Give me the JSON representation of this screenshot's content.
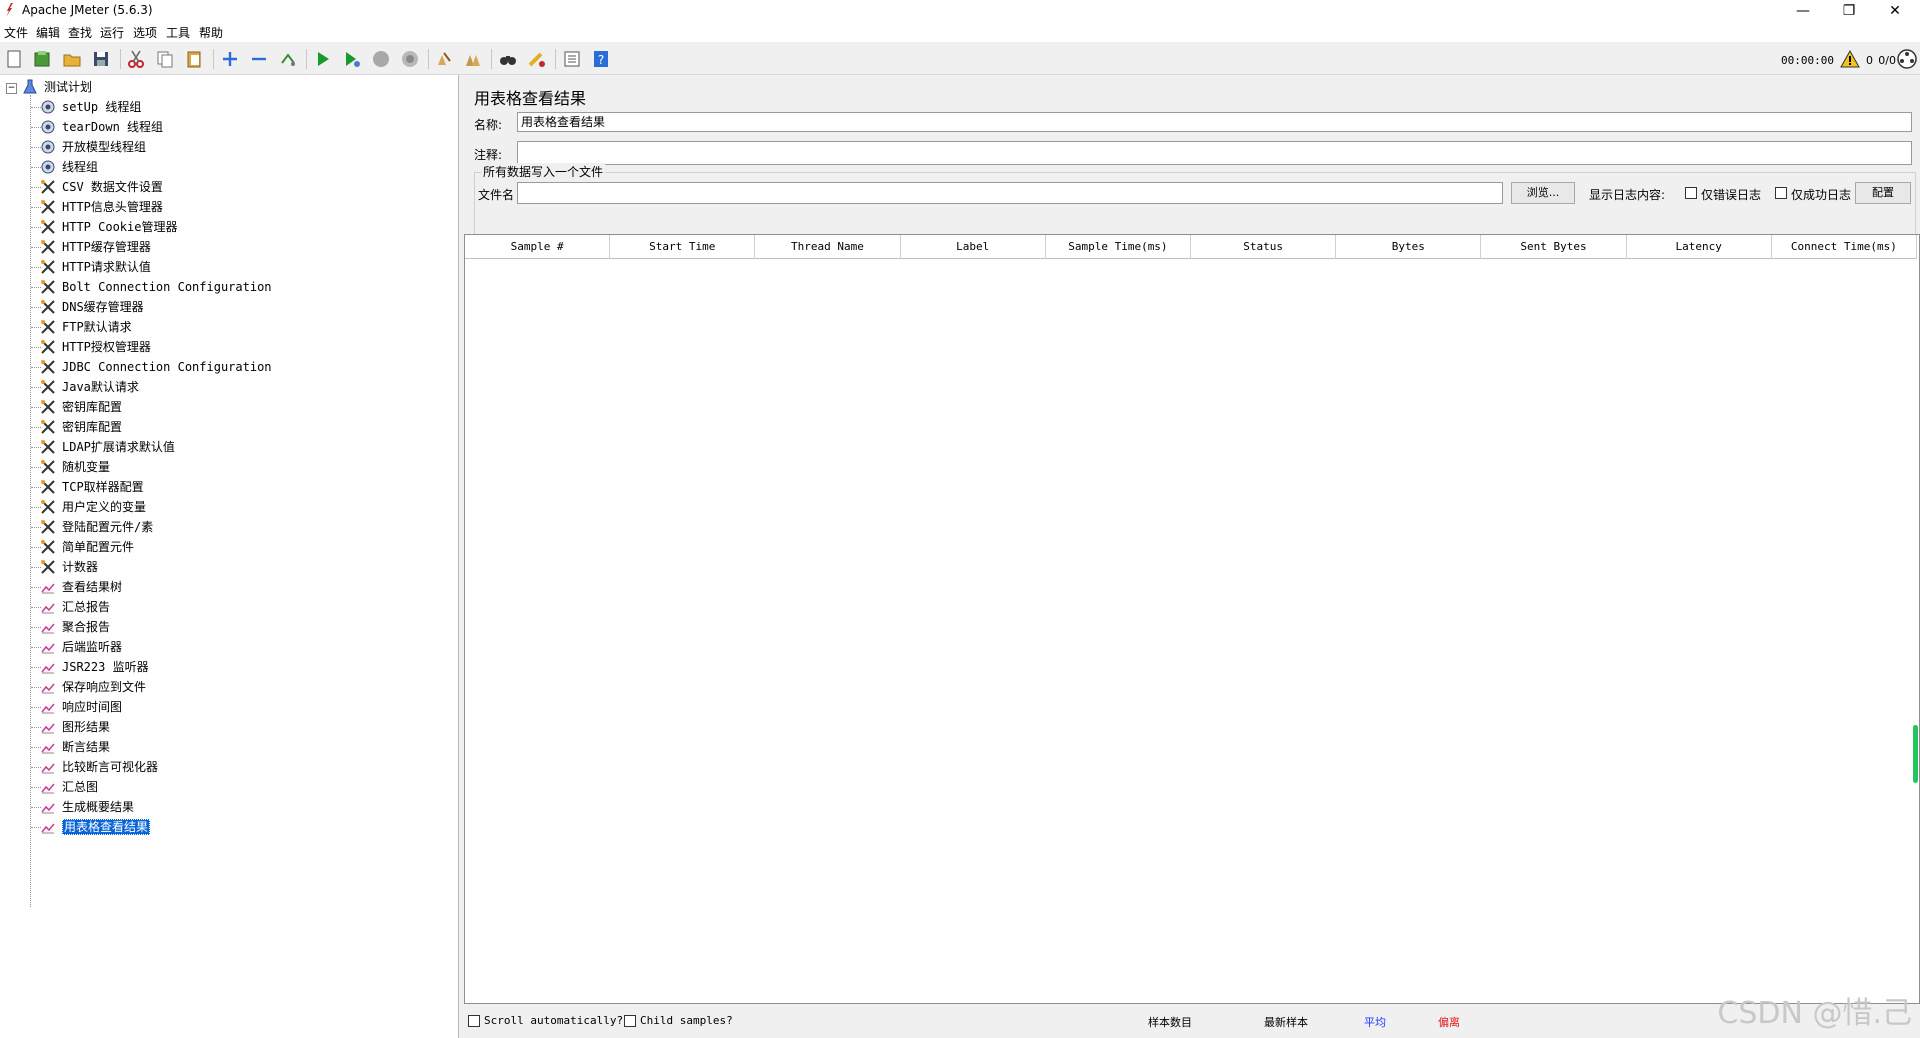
{
  "window": {
    "title": "Apache JMeter (5.6.3)",
    "minimize": "—",
    "restore": "❐",
    "close": "✕"
  },
  "menu": [
    "文件",
    "编辑",
    "查找",
    "运行",
    "选项",
    "工具",
    "帮助"
  ],
  "toolbar_status": {
    "elapsed": "00:00:00",
    "errors": "0",
    "threads": "0/0"
  },
  "tree": {
    "root": "测试计划",
    "items": [
      {
        "label": "setUp 线程组",
        "icon": "thread-group-icon"
      },
      {
        "label": "tearDown 线程组",
        "icon": "thread-group-icon"
      },
      {
        "label": "开放模型线程组",
        "icon": "thread-group-icon"
      },
      {
        "label": "线程组",
        "icon": "thread-group-icon"
      },
      {
        "label": "CSV 数据文件设置",
        "icon": "config-element-icon"
      },
      {
        "label": "HTTP信息头管理器",
        "icon": "config-element-icon"
      },
      {
        "label": "HTTP Cookie管理器",
        "icon": "config-element-icon"
      },
      {
        "label": "HTTP缓存管理器",
        "icon": "config-element-icon"
      },
      {
        "label": "HTTP请求默认值",
        "icon": "config-element-icon"
      },
      {
        "label": "Bolt Connection Configuration",
        "icon": "config-element-icon"
      },
      {
        "label": "DNS缓存管理器",
        "icon": "config-element-icon"
      },
      {
        "label": "FTP默认请求",
        "icon": "config-element-icon"
      },
      {
        "label": "HTTP授权管理器",
        "icon": "config-element-icon"
      },
      {
        "label": "JDBC Connection Configuration",
        "icon": "config-element-icon"
      },
      {
        "label": "Java默认请求",
        "icon": "config-element-icon"
      },
      {
        "label": "密钥库配置",
        "icon": "config-element-icon"
      },
      {
        "label": "密钥库配置",
        "icon": "config-element-icon"
      },
      {
        "label": "LDAP扩展请求默认值",
        "icon": "config-element-icon"
      },
      {
        "label": "随机变量",
        "icon": "config-element-icon"
      },
      {
        "label": "TCP取样器配置",
        "icon": "config-element-icon"
      },
      {
        "label": "用户定义的变量",
        "icon": "config-element-icon"
      },
      {
        "label": "登陆配置元件/素",
        "icon": "config-element-icon"
      },
      {
        "label": "简单配置元件",
        "icon": "config-element-icon"
      },
      {
        "label": "计数器",
        "icon": "config-element-icon"
      },
      {
        "label": "查看结果树",
        "icon": "listener-icon"
      },
      {
        "label": "汇总报告",
        "icon": "listener-icon"
      },
      {
        "label": "聚合报告",
        "icon": "listener-icon"
      },
      {
        "label": "后端监听器",
        "icon": "listener-icon"
      },
      {
        "label": "JSR223 监听器",
        "icon": "listener-icon"
      },
      {
        "label": "保存响应到文件",
        "icon": "listener-icon"
      },
      {
        "label": "响应时间图",
        "icon": "listener-icon"
      },
      {
        "label": "图形结果",
        "icon": "listener-icon"
      },
      {
        "label": "断言结果",
        "icon": "listener-icon"
      },
      {
        "label": "比较断言可视化器",
        "icon": "listener-icon"
      },
      {
        "label": "汇总图",
        "icon": "listener-icon"
      },
      {
        "label": "生成概要结果",
        "icon": "listener-icon"
      },
      {
        "label": "用表格查看结果",
        "icon": "listener-icon",
        "selected": true
      }
    ]
  },
  "panel": {
    "title": "用表格查看结果",
    "name_label": "名称:",
    "name_value": "用表格查看结果",
    "comment_label": "注释:",
    "comment_value": "",
    "file_section_title": "所有数据写入一个文件",
    "file_label": "文件名",
    "file_value": "",
    "browse_label": "浏览...",
    "log_content_label": "显示日志内容:",
    "errors_only_label": "仅错误日志",
    "success_only_label": "仅成功日志",
    "configure_label": "配置"
  },
  "table": {
    "columns": [
      "Sample #",
      "Start Time",
      "Thread Name",
      "Label",
      "Sample Time(ms)",
      "Status",
      "Bytes",
      "Sent Bytes",
      "Latency",
      "Connect Time(ms)"
    ]
  },
  "bottom": {
    "scroll_auto_label": "Scroll automatically?",
    "child_samples_label": "Child samples?",
    "sample_count_label": "样本数目",
    "latest_sample_label": "最新样本",
    "average_label": "平均",
    "deviation_label": "偏离",
    "average_color": "#1a3cff",
    "deviation_color": "#e01b1b"
  },
  "watermark": "CSDN @惜.己"
}
